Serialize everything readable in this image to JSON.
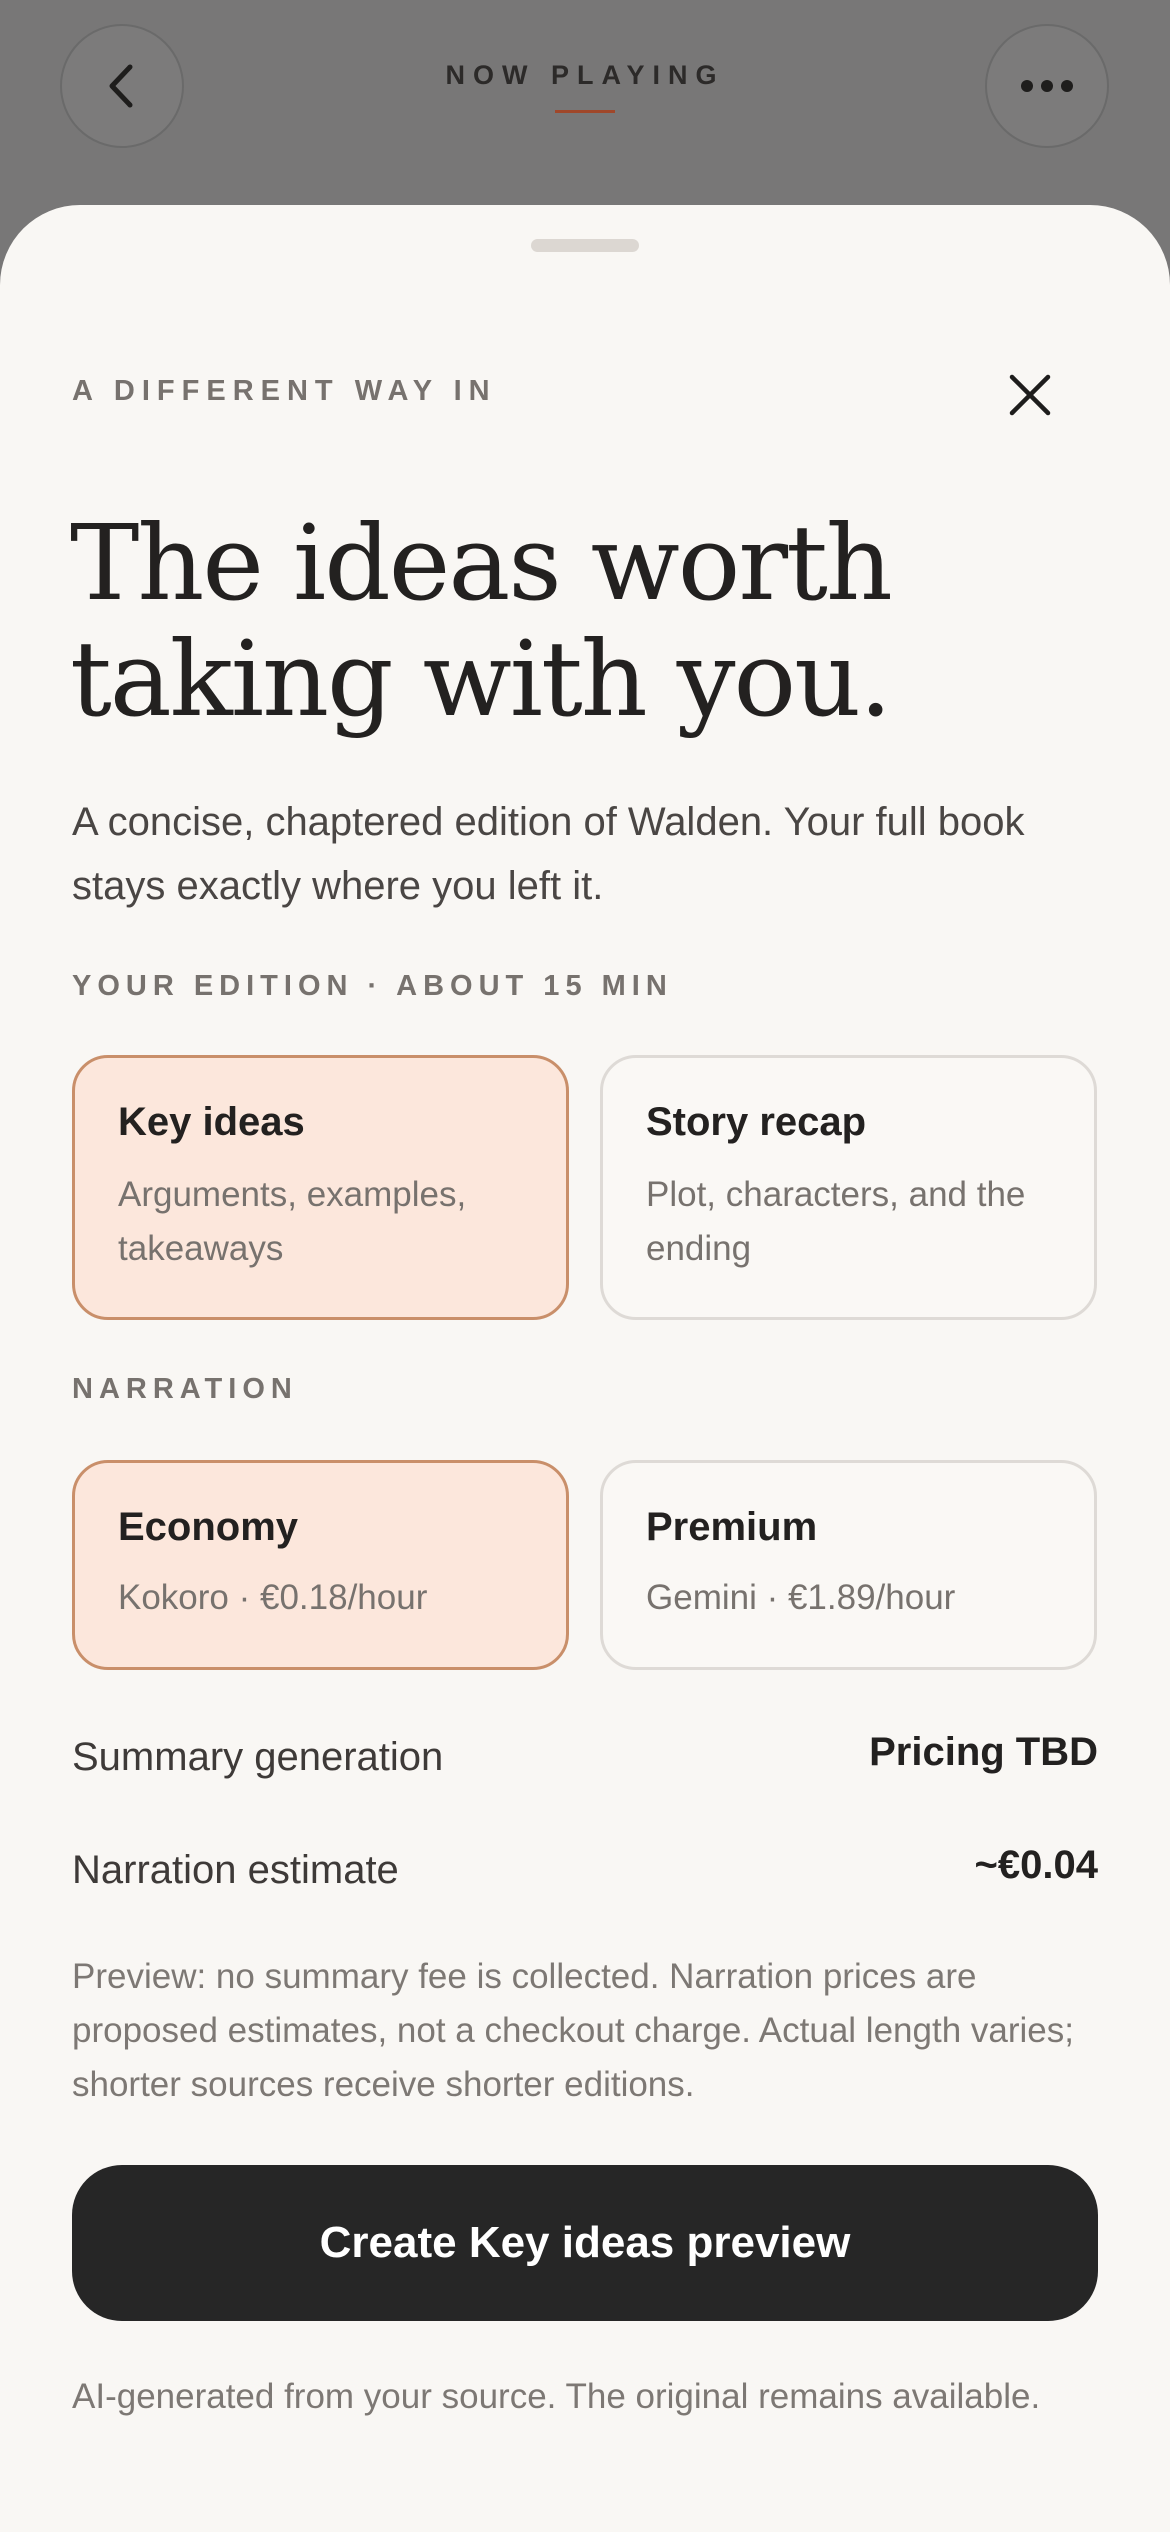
{
  "header": {
    "title": "NOW PLAYING",
    "back_icon": "chevron-left-icon",
    "more_icon": "ellipsis-icon"
  },
  "sheet": {
    "eyebrow": "A DIFFERENT WAY IN",
    "close_icon": "close-icon",
    "headline_line1": "The ideas worth",
    "headline_line2": "taking with you.",
    "subtitle": "A concise, chaptered edition of Walden. Your full book stays exactly where you left it.",
    "edition_label": "YOUR EDITION · ABOUT 15 MIN",
    "edition_options": [
      {
        "title": "Key ideas",
        "desc": "Arguments, examples, takeaways",
        "selected": true
      },
      {
        "title": "Story recap",
        "desc": "Plot, characters, and the ending",
        "selected": false
      }
    ],
    "narration_label": "NARRATION",
    "narration_options": [
      {
        "title": "Economy",
        "desc": "Kokoro · €0.18/hour",
        "selected": true
      },
      {
        "title": "Premium",
        "desc": "Gemini · €1.89/hour",
        "selected": false
      }
    ],
    "summary_row": {
      "label": "Summary generation",
      "value": "Pricing TBD"
    },
    "narration_row": {
      "label": "Narration estimate",
      "value": "~€0.04"
    },
    "fineprint": "Preview: no summary fee is collected. Narration prices are proposed estimates, not a checkout charge. Actual length varies; shorter sources receive shorter editions.",
    "cta_label": "Create Key ideas preview",
    "footnote": "AI-generated from your source. The original remains available."
  },
  "colors": {
    "accent": "#a0472a",
    "selected_bg": "#fce7dc",
    "selected_border": "#c98f6a",
    "cta_bg": "#262626"
  }
}
